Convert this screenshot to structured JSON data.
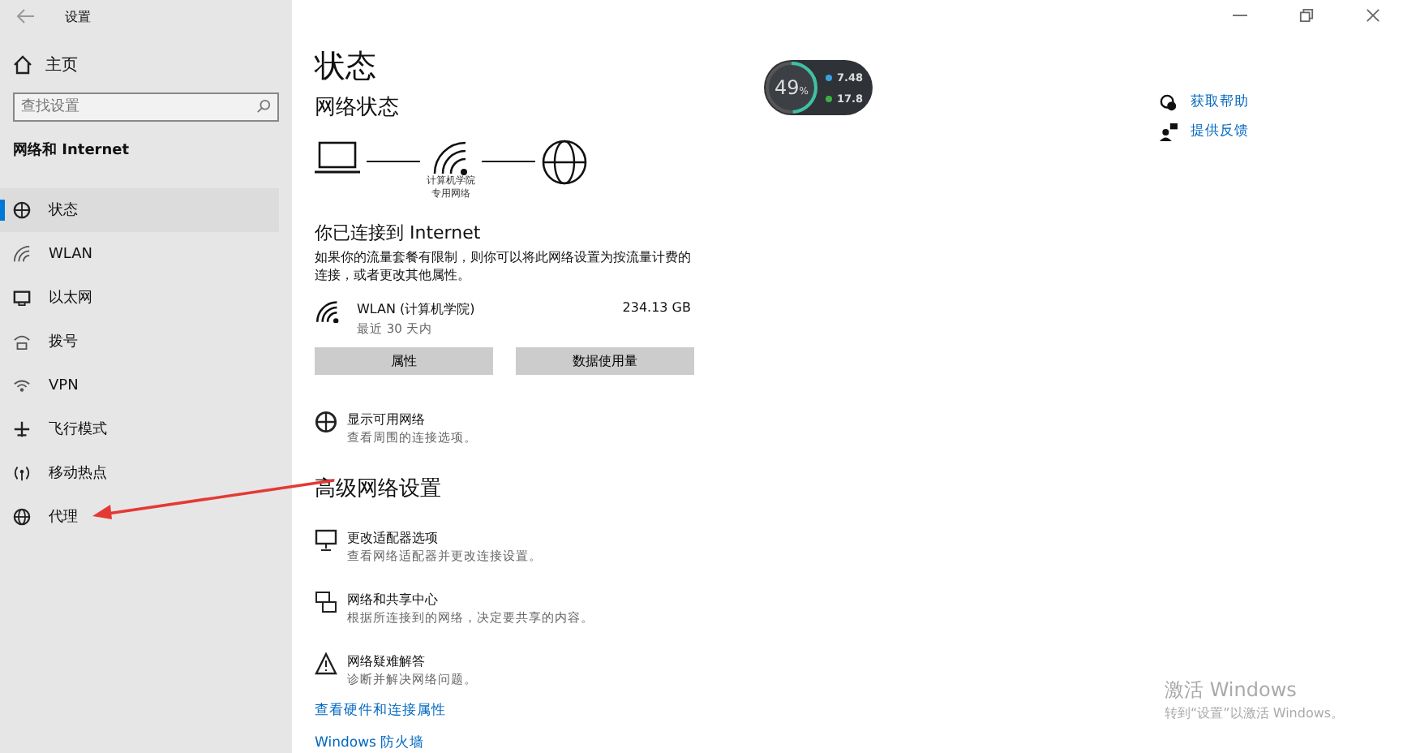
{
  "window": {
    "title": "设置"
  },
  "sidebar": {
    "home": "主页",
    "search": {
      "placeholder": "查找设置"
    },
    "section": "网络和 Internet",
    "items": [
      {
        "label": "状态",
        "selected": true
      },
      {
        "label": "WLAN",
        "selected": false
      },
      {
        "label": "以太网",
        "selected": false
      },
      {
        "label": "拨号",
        "selected": false
      },
      {
        "label": "VPN",
        "selected": false
      },
      {
        "label": "飞行模式",
        "selected": false
      },
      {
        "label": "移动热点",
        "selected": false
      },
      {
        "label": "代理",
        "selected": false
      }
    ]
  },
  "main": {
    "title": "状态",
    "network_status": "网络状态",
    "network_name": "计算机学院",
    "network_type": "专用网络",
    "connected_heading": "你已连接到 Internet",
    "connected_desc": "如果你的流量套餐有限制，则你可以将此网络设置为按流量计费的连接，或者更改其他属性。",
    "connection": {
      "name": "WLAN (计算机学院)",
      "period": "最近 30 天内",
      "usage": "234.13 GB"
    },
    "buttons": [
      "属性",
      "数据使用量"
    ],
    "show_networks": {
      "title": "显示可用网络",
      "desc": "查看周围的连接选项。"
    },
    "advanced_heading": "高级网络设置",
    "advanced_items": [
      {
        "title": "更改适配器选项",
        "desc": "查看网络适配器并更改连接设置。"
      },
      {
        "title": "网络和共享中心",
        "desc": "根据所连接到的网络，决定要共享的内容。"
      },
      {
        "title": "网络疑难解答",
        "desc": "诊断并解决网络问题。"
      }
    ],
    "links": [
      "查看硬件和连接属性",
      "Windows 防火墙"
    ]
  },
  "speed_widget": {
    "percent": "49",
    "unit": "%",
    "level": 0.49,
    "upload": "7.48",
    "download": "17.8"
  },
  "help": [
    "获取帮助",
    "提供反馈"
  ],
  "activation": {
    "title": "激活 Windows",
    "desc": "转到“设置”以激活 Windows。"
  }
}
